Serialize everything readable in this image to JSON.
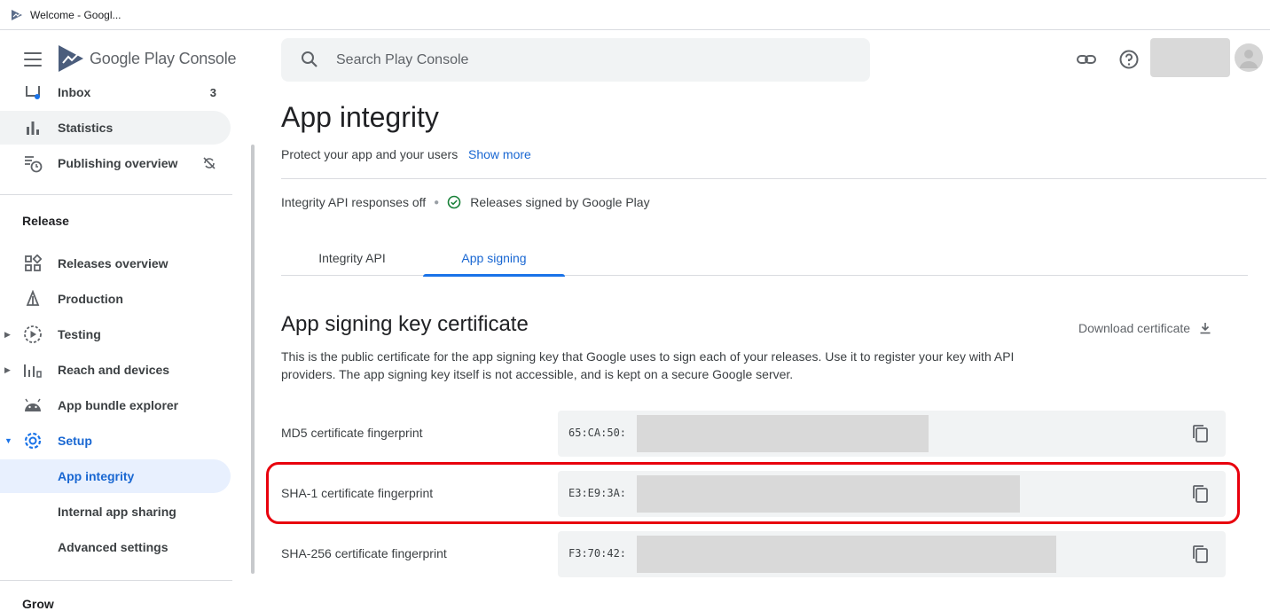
{
  "browser_tab": {
    "title": "Welcome - Googl..."
  },
  "sidebar": {
    "brand": "Google Play Console",
    "items_top": [
      {
        "label": "Inbox",
        "badge": "3",
        "icon": "inbox-icon"
      },
      {
        "label": "Statistics",
        "icon": "bar-chart-icon"
      },
      {
        "label": "Publishing overview",
        "icon": "publishing-overview-icon",
        "trailing_icon": "sync-off-icon"
      }
    ],
    "release_section": "Release",
    "release_items": [
      {
        "label": "Releases overview",
        "icon": "dashboard-grid-icon"
      },
      {
        "label": "Production",
        "icon": "production-icon"
      },
      {
        "label": "Testing",
        "icon": "play-circle-icon"
      },
      {
        "label": "Reach and devices",
        "icon": "reach-bars-icon"
      },
      {
        "label": "App bundle explorer",
        "icon": "android-icon"
      },
      {
        "label": "Setup",
        "icon": "gear-icon"
      },
      {
        "label": "App integrity"
      },
      {
        "label": "Internal app sharing"
      },
      {
        "label": "Advanced settings"
      }
    ],
    "grow_section": "Grow"
  },
  "topbar": {
    "search_placeholder": "Search Play Console"
  },
  "page": {
    "title": "App integrity",
    "subtitle": "Protect your app and your users",
    "show_more": "Show more",
    "status_1": "Integrity API responses off",
    "status_2": "Releases signed by Google Play",
    "tabs": [
      "Integrity API",
      "App signing"
    ],
    "active_tab": "App signing",
    "section_title": "App signing key certificate",
    "download_label": "Download certificate",
    "description": "This is the public certificate for the app signing key that Google uses to sign each of your releases. Use it to register your key with API providers. The app signing key itself is not accessible, and is kept on a secure Google server.",
    "fingerprints": [
      {
        "label": "MD5 certificate fingerprint",
        "value": "65:CA:50:"
      },
      {
        "label": "SHA-1 certificate fingerprint",
        "value": "E3:E9:3A:"
      },
      {
        "label": "SHA-256 certificate fingerprint",
        "value": "F3:70:42:"
      }
    ]
  },
  "colors": {
    "accent": "#1a73e8",
    "highlight": "#e8000d",
    "active_nav_bg": "#e8f0fe"
  }
}
